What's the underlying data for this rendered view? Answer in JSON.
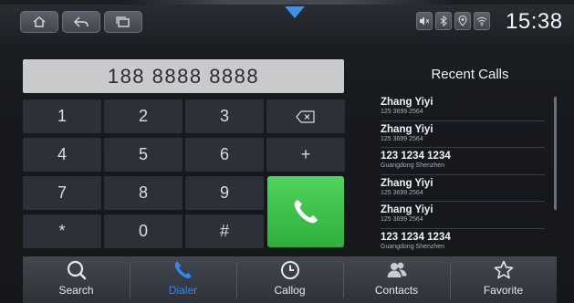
{
  "status_bar": {
    "time": "15:38",
    "nav_buttons": [
      {
        "icon": "home-icon"
      },
      {
        "icon": "back-icon"
      },
      {
        "icon": "recent-apps-icon"
      }
    ],
    "system_icons": [
      "mute-icon",
      "bluetooth-icon",
      "location-icon",
      "wifi-icon"
    ]
  },
  "dialer": {
    "number": "188 8888 8888",
    "keys": [
      {
        "label": "1"
      },
      {
        "label": "2"
      },
      {
        "label": "3"
      },
      {
        "label": "4"
      },
      {
        "label": "5"
      },
      {
        "label": "6"
      },
      {
        "label": "7"
      },
      {
        "label": "8"
      },
      {
        "label": "9"
      },
      {
        "label": "*"
      },
      {
        "label": "0"
      },
      {
        "label": "#"
      }
    ],
    "plus_label": "+",
    "call_color": "#3cc249"
  },
  "recent_calls": {
    "title": "Recent Calls",
    "items": [
      {
        "name": "Zhang Yiyi",
        "detail": "125 3699 2564"
      },
      {
        "name": "Zhang Yiyi",
        "detail": "125 3699 2564"
      },
      {
        "name": "123 1234 1234",
        "detail": "Guangdong Shenzhen"
      },
      {
        "name": "Zhang Yiyi",
        "detail": "125 3699 2564"
      },
      {
        "name": "Zhang Yiyi",
        "detail": "125 3699 2564"
      },
      {
        "name": "123 1234 1234",
        "detail": "Guangdong Shenzhen"
      }
    ]
  },
  "tabs": [
    {
      "label": "Search",
      "icon": "search-icon"
    },
    {
      "label": "Dialer",
      "icon": "phone-icon",
      "active": true
    },
    {
      "label": "Callog",
      "icon": "clock-icon"
    },
    {
      "label": "Contacts",
      "icon": "contacts-icon"
    },
    {
      "label": "Favorite",
      "icon": "star-icon"
    }
  ],
  "colors": {
    "accent": "#2e88f0",
    "call_green": "#3cc249"
  }
}
